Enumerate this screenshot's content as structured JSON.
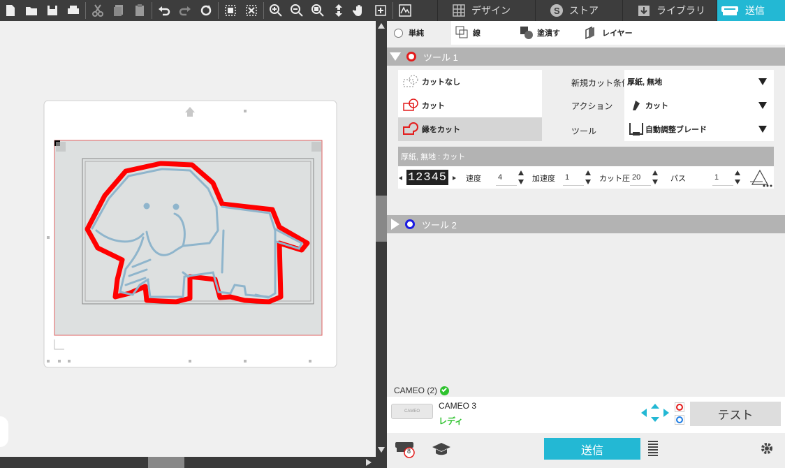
{
  "tabs": [
    {
      "label": "デザイン",
      "icon": "grid-icon"
    },
    {
      "label": "ストア",
      "icon": "store-s-icon"
    },
    {
      "label": "ライブラリ",
      "icon": "library-download-icon"
    },
    {
      "label": "送信",
      "icon": "cutter-send-icon"
    }
  ],
  "subtabs": {
    "simple": "単純",
    "line": "線",
    "fill": "塗潰す",
    "layer": "レイヤー"
  },
  "tool1": {
    "title": "ツール 1",
    "color": "#e31b1b",
    "options": {
      "no_cut": "カットなし",
      "cut": "カット",
      "cut_edge": "縁をカット"
    },
    "material_label": "新規カット条件",
    "material_value": "厚紙, 無地",
    "action_label": "アクション",
    "action_value": "カット",
    "tool_label": "ツール",
    "tool_value": "自動調整ブレード",
    "settings_header": "厚紙, 無地 : カット",
    "blade_digits": "12345",
    "speed_label": "速度",
    "speed_value": "4",
    "accel_label": "加速度",
    "accel_value": "1",
    "force_label": "カット圧",
    "force_value": "20",
    "passes_label": "パス",
    "passes_value": "1"
  },
  "tool2": {
    "title": "ツール 2",
    "color": "#1b1be3"
  },
  "device": {
    "header": "CAMEO (2)",
    "name": "CAMEO 3",
    "status": "レディ",
    "status_color": "#2ec22e",
    "device_label": "CAMEO",
    "test_button": "テスト",
    "send_button": "送信",
    "badge": "8"
  },
  "colors": {
    "accent": "#23b8d4",
    "cut_line": "#ff0000",
    "drawing": "#8fb5cc"
  }
}
